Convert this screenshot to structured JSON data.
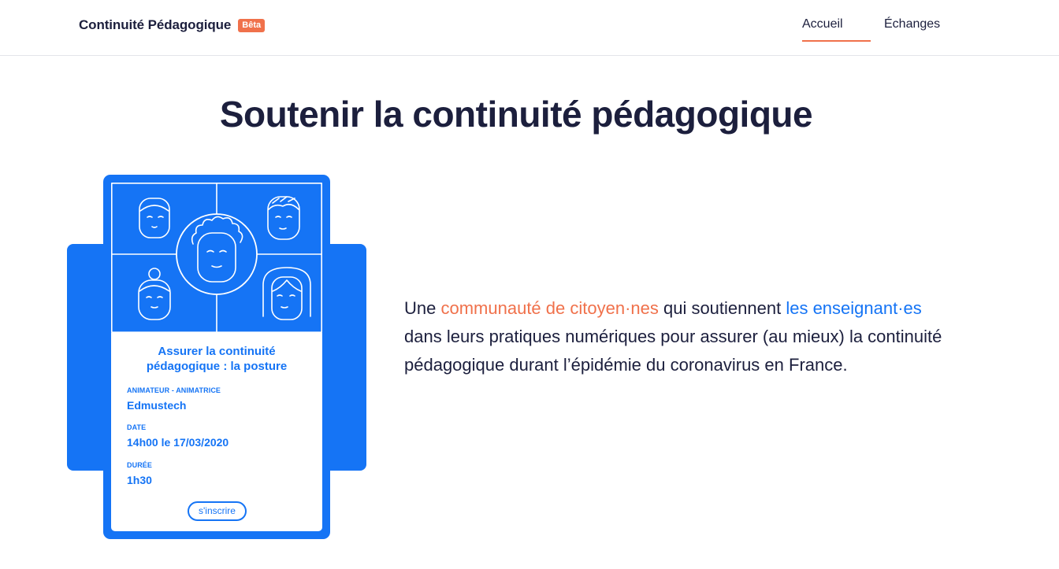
{
  "header": {
    "brand": "Continuité Pédagogique",
    "badge": "Bêta",
    "nav": [
      {
        "label": "Accueil",
        "active": true
      },
      {
        "label": "Échanges",
        "active": false
      }
    ]
  },
  "hero": {
    "title": "Soutenir la continuité pédagogique"
  },
  "card": {
    "title_line1": "Assurer la continuité",
    "title_line2": "pédagogique : la posture",
    "host_label": "ANIMATEUR - ANIMATRICE",
    "host_value": "Edmustech",
    "date_label": "DATE",
    "date_value": "14h00 le 17/03/2020",
    "duration_label": "DURÉE",
    "duration_value": "1h30",
    "signup_label": "s'inscrire",
    "illustration_icons": [
      "person-face-icon",
      "person-face-icon",
      "person-face-icon",
      "person-face-icon",
      "person-face-icon"
    ]
  },
  "intro": {
    "part1": "Une ",
    "highlight1": "communauté de citoyen·nes",
    "part2": " qui soutiennent ",
    "highlight2": "les enseignant·es",
    "part3": " dans leurs pratiques numériques pour assurer (au mieux) la continuité pédagogique durant l’épidémie du coronavirus en France."
  },
  "colors": {
    "primary_blue": "#1574f5",
    "accent_orange": "#f0714b",
    "text_dark": "#1c1f3d"
  }
}
